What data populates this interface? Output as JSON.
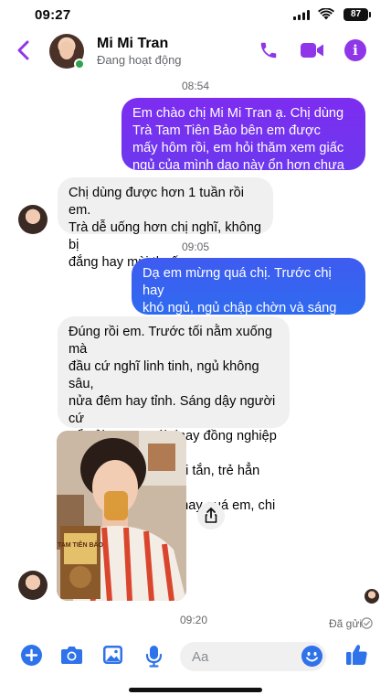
{
  "status_bar": {
    "time": "09:27",
    "battery": "87"
  },
  "header": {
    "name": "Mi Mi Tran",
    "status": "Đang hoạt động"
  },
  "colors": {
    "accent": "#8f37e8",
    "bubble_out_top": "#7b2ff0",
    "bubble_out_bottom": "#2f6bf0",
    "bubble_in": "#f0f0f0",
    "online": "#31a24c"
  },
  "timestamps": {
    "t1": "08:54",
    "t2": "09:05",
    "t3": "09:20"
  },
  "messages": {
    "m1": "Em chào chị Mi Mi Tran ạ. Chị dùng\nTrà Tam Tiên Bảo bên em được\nmấy hôm rồi, em hỏi thăm xem giấc\nngủ của mình dạo này ổn hơn chưa ạ?",
    "m2": "Chị dùng được hơn 1 tuần rồi em.\nTrà dễ uống hơn chị nghĩ, không bị\nđắng hay mùi thuốc.",
    "m3": "Dạ em mừng quá chị. Trước chị hay\nkhó ngủ, ngủ chập chờn và sáng dậy\nvẫn thấy mệt đúng không ạ?",
    "m4": "Đúng rồi em. Trước tối nằm xuống mà\nđầu cứ nghĩ linh tinh, ngủ không sâu,\nnửa đêm hay tỉnh. Sáng dậy người cứ\nuể oải. Được cái dnay đồng nghiệp với\nchồng bảo nhìn tươi tắn, trẻ hẳn ra, tóc\ncũng đỡ rụng hẳn..hay quá em, chi\nđang uống đây"
  },
  "photo": {
    "package_text": "TAM TIÊN BẢO"
  },
  "receipt": {
    "status": "Đã gửi"
  },
  "composer": {
    "placeholder": "Aa"
  },
  "icons": [
    "back-icon",
    "call-icon",
    "video-icon",
    "info-icon",
    "plus-icon",
    "camera-icon",
    "gallery-icon",
    "mic-icon",
    "emoji-icon",
    "like-icon",
    "share-icon"
  ]
}
